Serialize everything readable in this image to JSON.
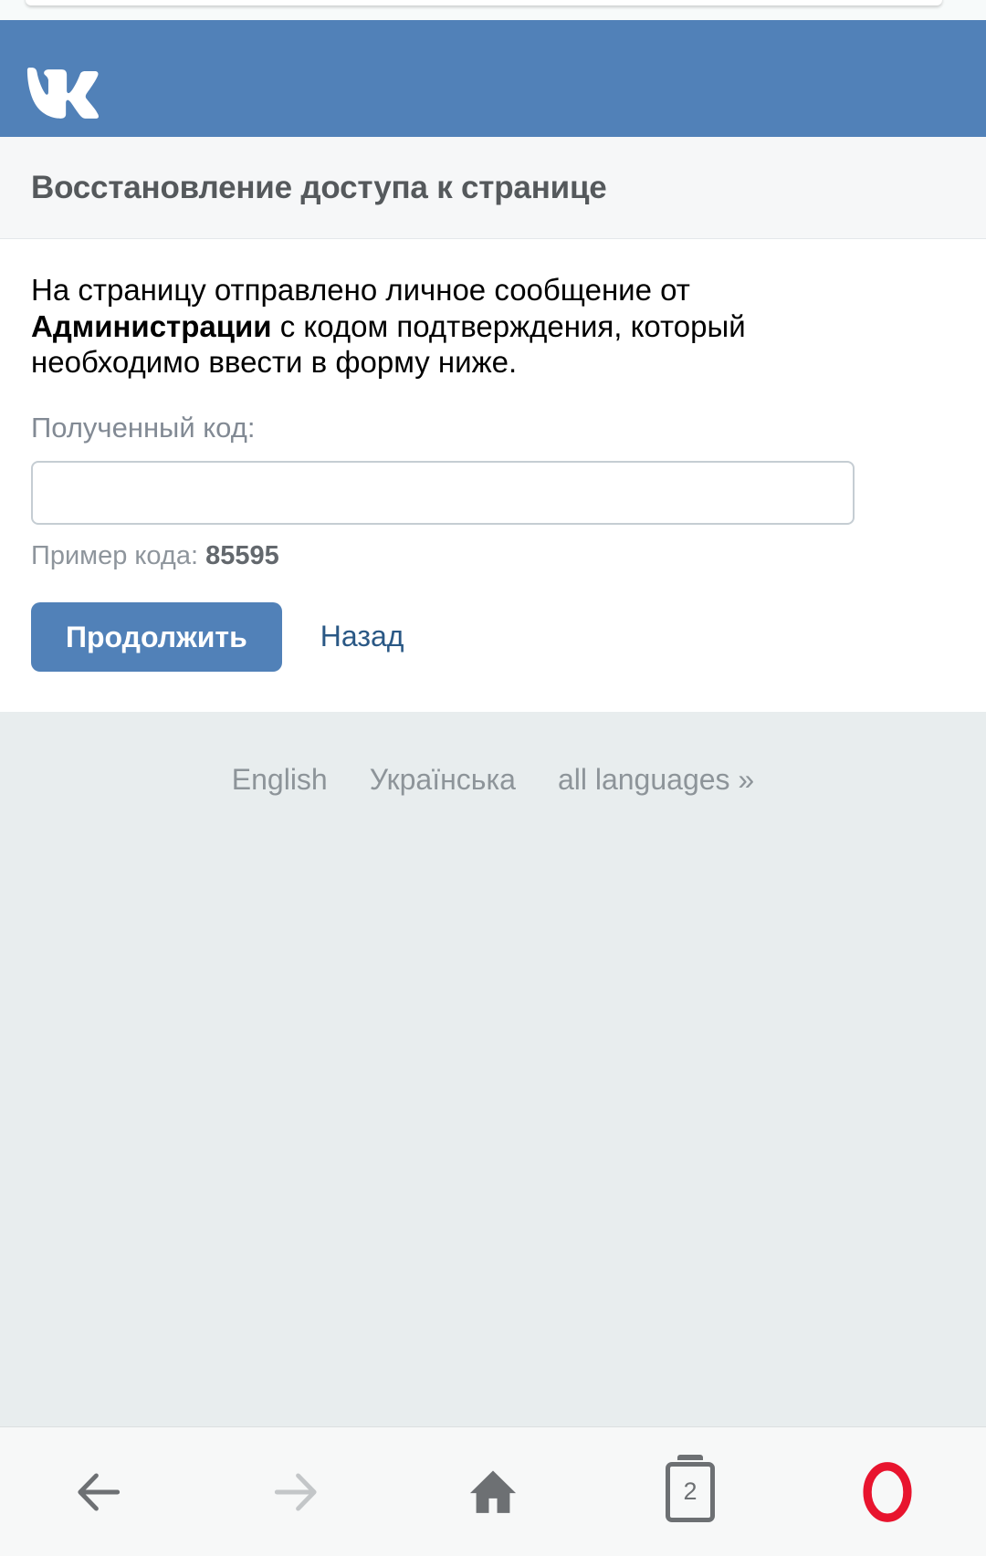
{
  "browser": {
    "name": "opera",
    "toolbar": {
      "back_label": "Назад",
      "forward_label": "Вперёд",
      "home_label": "Домой",
      "tabs_count": "2",
      "opera_menu_label": "Opera"
    }
  },
  "header": {
    "logo": "vk-logo",
    "brand_color": "#5181b8"
  },
  "page": {
    "title": "Восстановление доступа к странице"
  },
  "content": {
    "intro_part1": "На страницу отправлено личное сообщение от ",
    "intro_bold": "Администрации",
    "intro_part2": " с кодом подтверждения, который необходимо ввести в форму ниже.",
    "field_label": "Полученный код:",
    "code_input_value": "",
    "code_input_placeholder": "",
    "hint_label": "Пример кода: ",
    "hint_value": "85595",
    "submit_label": "Продолжить",
    "back_label": "Назад"
  },
  "footer": {
    "languages": [
      {
        "label": "English"
      },
      {
        "label": "Українська"
      },
      {
        "label": "all languages »"
      }
    ]
  },
  "colors": {
    "vk_blue": "#5181b8",
    "link_blue": "#2a5885",
    "muted_gray": "#8d9499",
    "footer_bg": "#e8edee",
    "opera_red": "#e8142e"
  }
}
